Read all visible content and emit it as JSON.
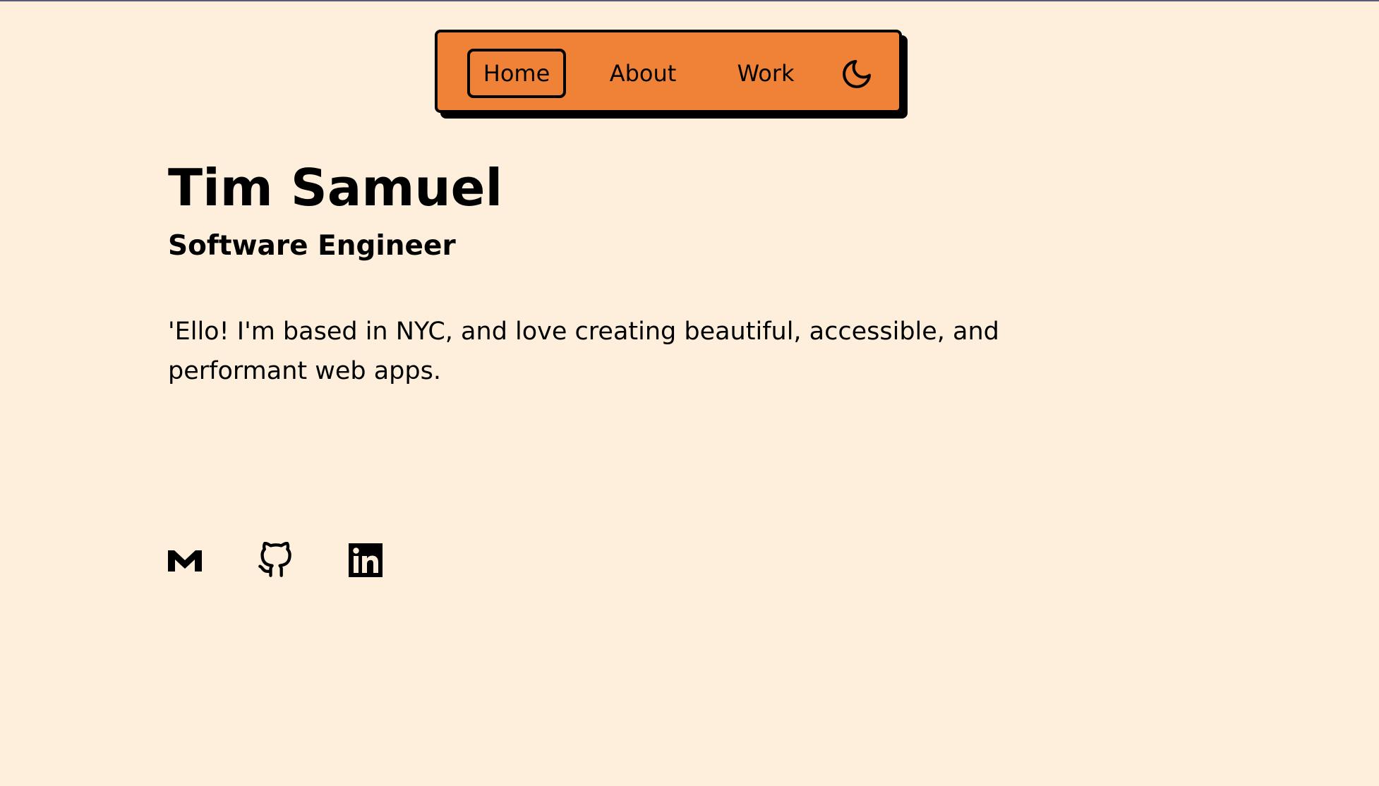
{
  "nav": {
    "items": [
      {
        "label": "Home",
        "active": true
      },
      {
        "label": "About",
        "active": false
      },
      {
        "label": "Work",
        "active": false
      }
    ],
    "theme_toggle_icon": "moon-icon"
  },
  "hero": {
    "name": "Tim Samuel",
    "role": "Software Engineer",
    "intro": "'Ello! I'm based in NYC, and love creating beautiful, accessible, and performant web apps."
  },
  "social": {
    "icons": [
      "gmail-icon",
      "github-icon",
      "linkedin-icon"
    ]
  },
  "colors": {
    "background": "#fdefdc",
    "nav_background": "#f08238",
    "text": "#000000"
  }
}
